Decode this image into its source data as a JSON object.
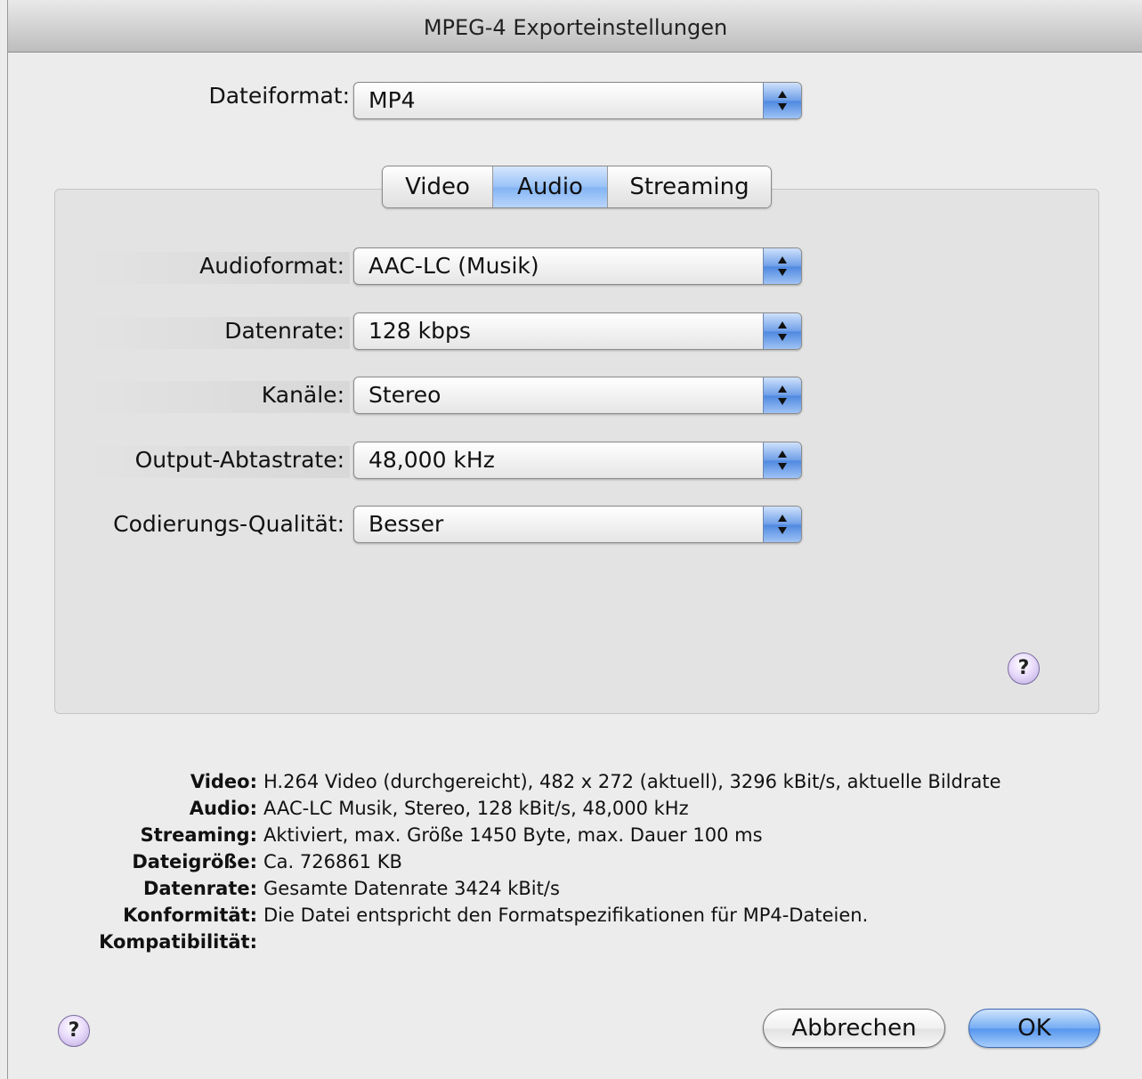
{
  "window": {
    "title": "MPEG-4 Exporteinstellungen"
  },
  "file_format": {
    "label": "Dateiformat:",
    "value": "MP4"
  },
  "tabs": [
    {
      "label": "Video",
      "selected": false
    },
    {
      "label": "Audio",
      "selected": true
    },
    {
      "label": "Streaming",
      "selected": false
    }
  ],
  "audio": {
    "format": {
      "label": "Audioformat:",
      "value": "AAC-LC (Musik)"
    },
    "bitrate": {
      "label": "Datenrate:",
      "value": "128 kbps"
    },
    "channels": {
      "label": "Kanäle:",
      "value": "Stereo"
    },
    "sample_rate": {
      "label": "Output-Abtastrate:",
      "value": "48,000 kHz"
    },
    "quality": {
      "label": "Codierungs-Qualität:",
      "value": "Besser"
    }
  },
  "help_glyph": "?",
  "summary": [
    {
      "key": "Video:",
      "value": "H.264 Video (durchgereicht), 482 x 272 (aktuell), 3296 kBit/s, aktuelle Bildrate"
    },
    {
      "key": "Audio:",
      "value": "AAC-LC Musik, Stereo, 128 kBit/s, 48,000 kHz"
    },
    {
      "key": "Streaming:",
      "value": "Aktiviert, max. Größe 1450 Byte, max. Dauer 100 ms"
    },
    {
      "key": "Dateigröße:",
      "value": "Ca. 726861 KB"
    },
    {
      "key": "Datenrate:",
      "value": "Gesamte Datenrate 3424 kBit/s"
    },
    {
      "key": "Konformität:",
      "value": "Die Datei entspricht den Formatspezifikationen für MP4-Dateien."
    },
    {
      "key": "Kompatibilität:",
      "value": ""
    }
  ],
  "buttons": {
    "cancel": "Abbrechen",
    "ok": "OK"
  },
  "colors": {
    "accent": "#6f9fe8",
    "help_button": "#e9dcfb",
    "background": "#ececec"
  }
}
